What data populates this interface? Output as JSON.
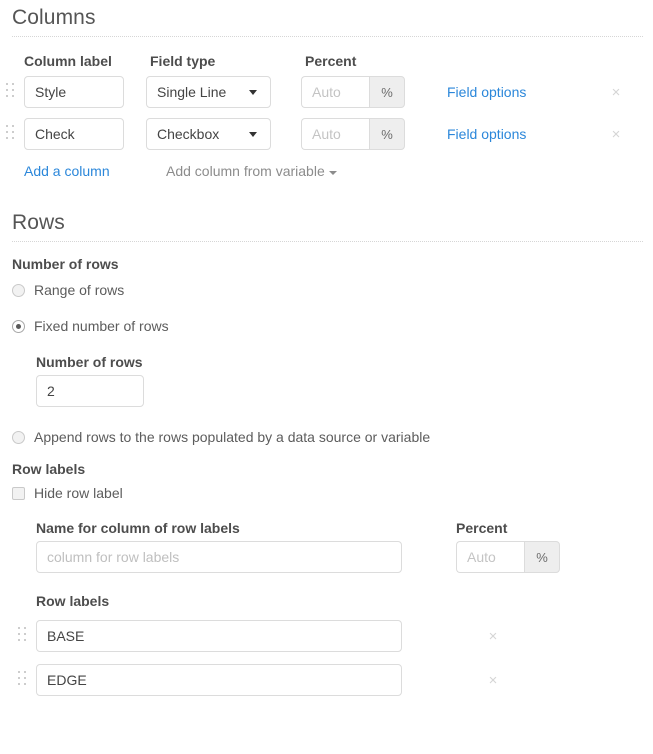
{
  "columns_section": {
    "title": "Columns",
    "headers": {
      "column_label": "Column label",
      "field_type": "Field type",
      "percent": "Percent"
    },
    "rows": [
      {
        "label_value": "Style",
        "field_type": "Single Line",
        "percent_placeholder": "Auto",
        "percent_addon": "%",
        "field_options_label": "Field options",
        "remove_icon": "×"
      },
      {
        "label_value": "Check",
        "field_type": "Checkbox",
        "percent_placeholder": "Auto",
        "percent_addon": "%",
        "field_options_label": "Field options",
        "remove_icon": "×"
      }
    ],
    "add_a_column_label": "Add a column",
    "add_column_from_variable_label": "Add column from variable"
  },
  "rows_section": {
    "title": "Rows",
    "number_of_rows_label": "Number of rows",
    "options": [
      {
        "label": "Range of rows",
        "selected": false
      },
      {
        "label": "Fixed number of rows",
        "selected": true
      },
      {
        "label": "Append rows to the rows populated by a data source or variable",
        "selected": false
      }
    ],
    "number_of_rows_field_label": "Number of rows",
    "number_of_rows_value": "2",
    "row_labels_heading": "Row labels",
    "hide_row_label": {
      "label": "Hide row label",
      "checked": false
    },
    "name_for_column_label": "Name for column of row labels",
    "name_for_column_placeholder": "column for row labels",
    "percent_label": "Percent",
    "percent_placeholder": "Auto",
    "percent_addon": "%",
    "row_labels_list_label": "Row labels",
    "row_labels": [
      {
        "value": "BASE",
        "remove_icon": "×"
      },
      {
        "value": "EDGE",
        "remove_icon": "×"
      }
    ]
  },
  "colors": {
    "link": "#2b87da",
    "heading": "#555555",
    "label": "#4d4d4d",
    "muted": "#8c8c8c"
  }
}
